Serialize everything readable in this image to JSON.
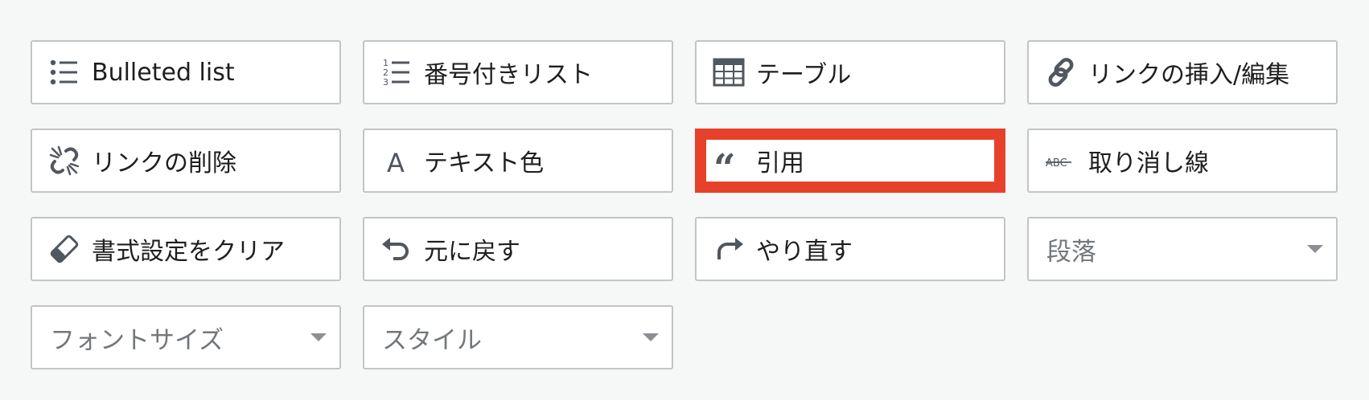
{
  "toolbar": {
    "bulleted_list": {
      "label": "Bulleted list",
      "icon": "bulleted-list-icon"
    },
    "numbered_list": {
      "label": "番号付きリスト",
      "icon": "numbered-list-icon"
    },
    "table": {
      "label": "テーブル",
      "icon": "table-icon"
    },
    "link": {
      "label": "リンクの挿入/編集",
      "icon": "link-icon"
    },
    "unlink": {
      "label": "リンクの削除",
      "icon": "unlink-icon"
    },
    "text_color": {
      "label": "テキスト色",
      "icon": "text-color-icon"
    },
    "quote": {
      "label": "引用",
      "icon": "quote-icon",
      "highlighted": true
    },
    "strikethrough": {
      "label": "取り消し線",
      "icon": "strikethrough-icon"
    },
    "clear_formatting": {
      "label": "書式設定をクリア",
      "icon": "eraser-icon"
    },
    "undo": {
      "label": "元に戻す",
      "icon": "undo-icon"
    },
    "redo": {
      "label": "やり直す",
      "icon": "redo-icon"
    },
    "paragraph_select": {
      "value": "段落",
      "icon": "dropdown-caret-icon"
    },
    "font_size_select": {
      "value": "フォントサイズ",
      "icon": "dropdown-caret-icon"
    },
    "style_select": {
      "value": "スタイル",
      "icon": "dropdown-caret-icon"
    }
  },
  "colors": {
    "background": "#f6f7f7",
    "button_border": "#c3c4c7",
    "icon": "#50575e",
    "text": "#1e1e1e",
    "placeholder_text": "#72777c",
    "highlight": "#e8412b"
  }
}
